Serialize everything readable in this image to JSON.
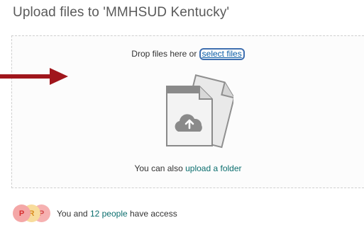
{
  "dialog": {
    "title": "Upload files to 'MMHSUD Kentucky'"
  },
  "dropzone": {
    "drop_prefix": "Drop files here or ",
    "select_files_label": "select files",
    "also_prefix": "You can also ",
    "upload_folder_label": "upload a folder",
    "illustration_icon": "cloud-upload-files-icon"
  },
  "access": {
    "avatars": [
      {
        "initial": "P",
        "color": "#f4a7a7"
      },
      {
        "initial": "R",
        "color": "#f8dc9c"
      },
      {
        "initial": "P",
        "color": "#f6b1b1"
      }
    ],
    "prefix": "You and ",
    "people_link": "12 people",
    "suffix": " have access"
  },
  "colors": {
    "link": "#0b6e6e",
    "annotation_arrow": "#a0161c"
  }
}
